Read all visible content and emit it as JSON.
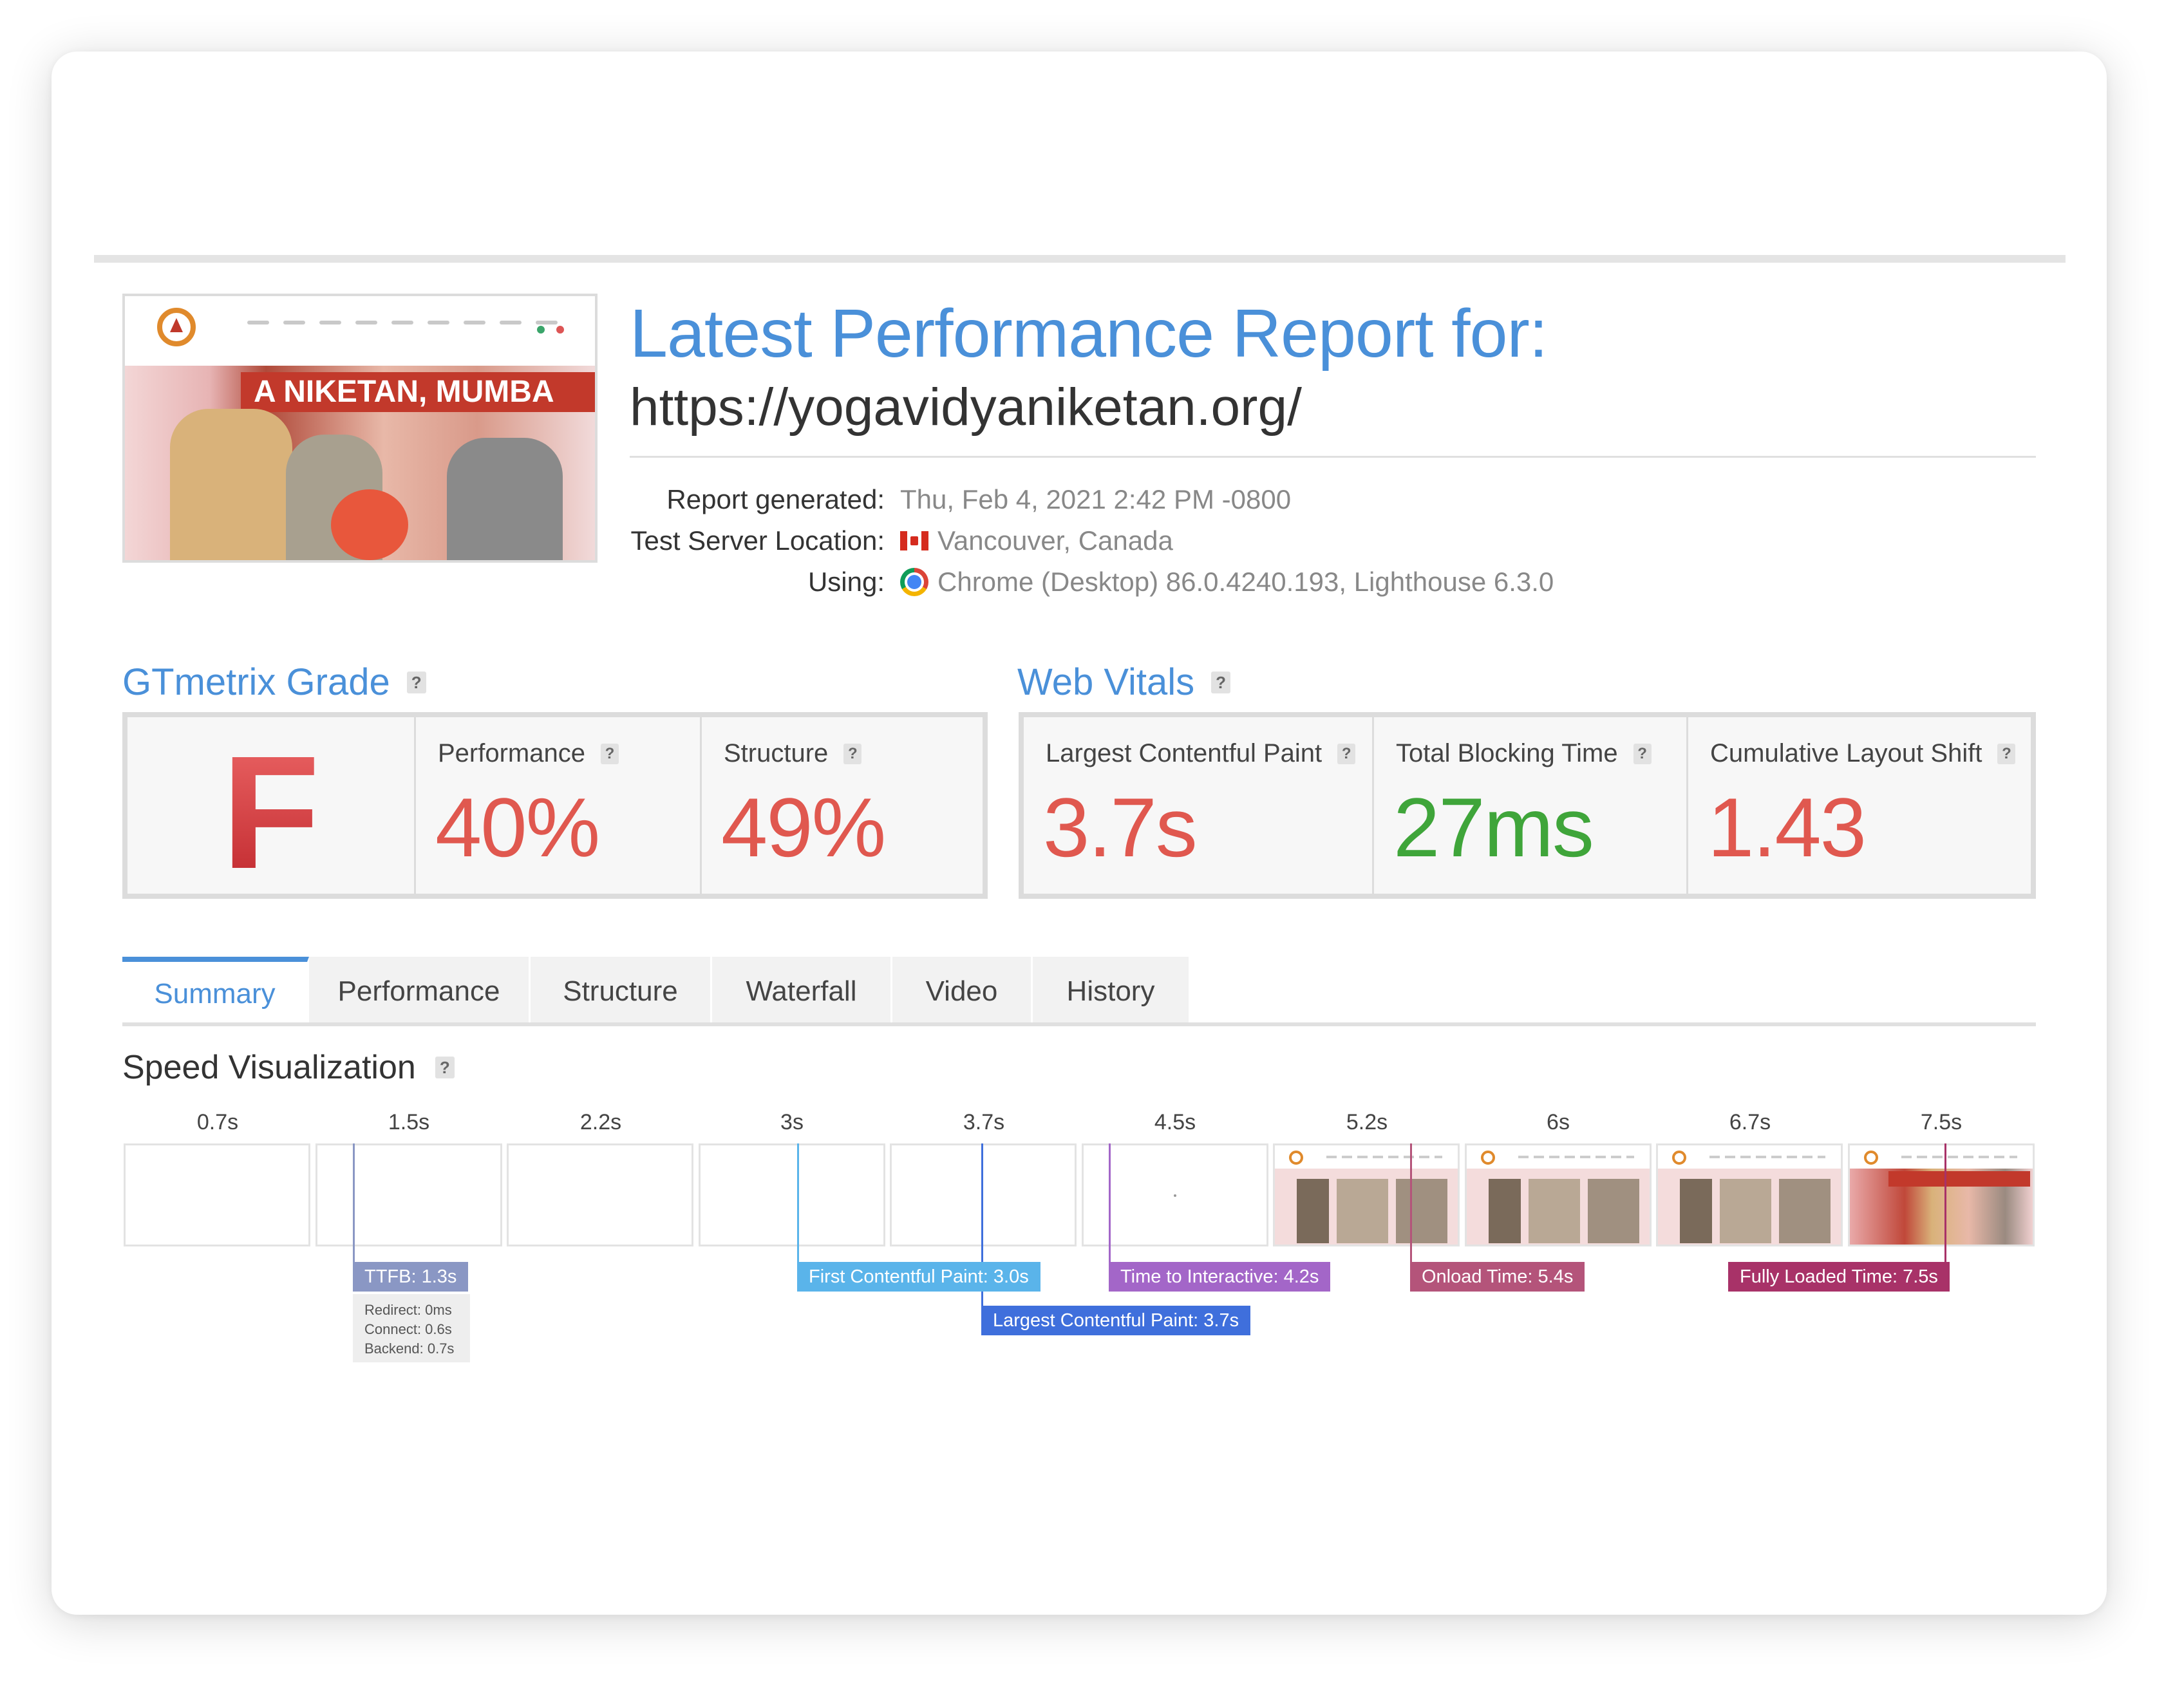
{
  "report": {
    "title": "Latest Performance Report for:",
    "url": "https://yogavidyaniketan.org/",
    "thumbnail_banner": "A NIKETAN, MUMBA",
    "meta": [
      {
        "label": "Report generated:",
        "value": "Thu, Feb 4, 2021 2:42 PM -0800",
        "icon": "none"
      },
      {
        "label": "Test Server Location:",
        "value": "Vancouver, Canada",
        "icon": "canada-flag-icon"
      },
      {
        "label": "Using:",
        "value": "Chrome (Desktop) 86.0.4240.193, Lighthouse 6.3.0",
        "icon": "chrome-icon"
      }
    ]
  },
  "grade": {
    "section_title": "GTmetrix Grade",
    "help": "?",
    "letter": "F",
    "performance_label": "Performance",
    "performance_value": "40%",
    "structure_label": "Structure",
    "structure_value": "49%"
  },
  "vitals": {
    "section_title": "Web Vitals",
    "help": "?",
    "items": [
      {
        "label": "Largest Contentful Paint",
        "value": "3.7s",
        "color": "#e0584f"
      },
      {
        "label": "Total Blocking Time",
        "value": "27ms",
        "color": "#3fa53a"
      },
      {
        "label": "Cumulative Layout Shift",
        "value": "1.43",
        "color": "#e0584f"
      }
    ]
  },
  "tabs": [
    {
      "label": "Summary",
      "active": true
    },
    {
      "label": "Performance",
      "active": false
    },
    {
      "label": "Structure",
      "active": false
    },
    {
      "label": "Waterfall",
      "active": false
    },
    {
      "label": "Video",
      "active": false
    },
    {
      "label": "History",
      "active": false
    }
  ],
  "speed": {
    "title": "Speed Visualization",
    "help": "?",
    "frame_times": [
      "0.7s",
      "1.5s",
      "2.2s",
      "3s",
      "3.7s",
      "4.5s",
      "5.2s",
      "6s",
      "6.7s",
      "7.5s"
    ],
    "markers": [
      {
        "label": "TTFB: 1.3s",
        "color": "#8a97c4"
      },
      {
        "label": "First Contentful Paint: 3.0s",
        "color": "#5ab4ea"
      },
      {
        "label": "Largest Contentful Paint: 3.7s",
        "color": "#3f6fdc"
      },
      {
        "label": "Time to Interactive: 4.2s",
        "color": "#a366c8"
      },
      {
        "label": "Onload Time: 5.4s",
        "color": "#b4547a"
      },
      {
        "label": "Fully Loaded Time: 7.5s",
        "color": "#a83268"
      }
    ],
    "ttfb_detail": [
      "Redirect: 0ms",
      "Connect: 0.6s",
      "Backend: 0.7s"
    ]
  },
  "colors": {
    "accent": "#4a90d9",
    "grade_fail": "#c83232"
  }
}
